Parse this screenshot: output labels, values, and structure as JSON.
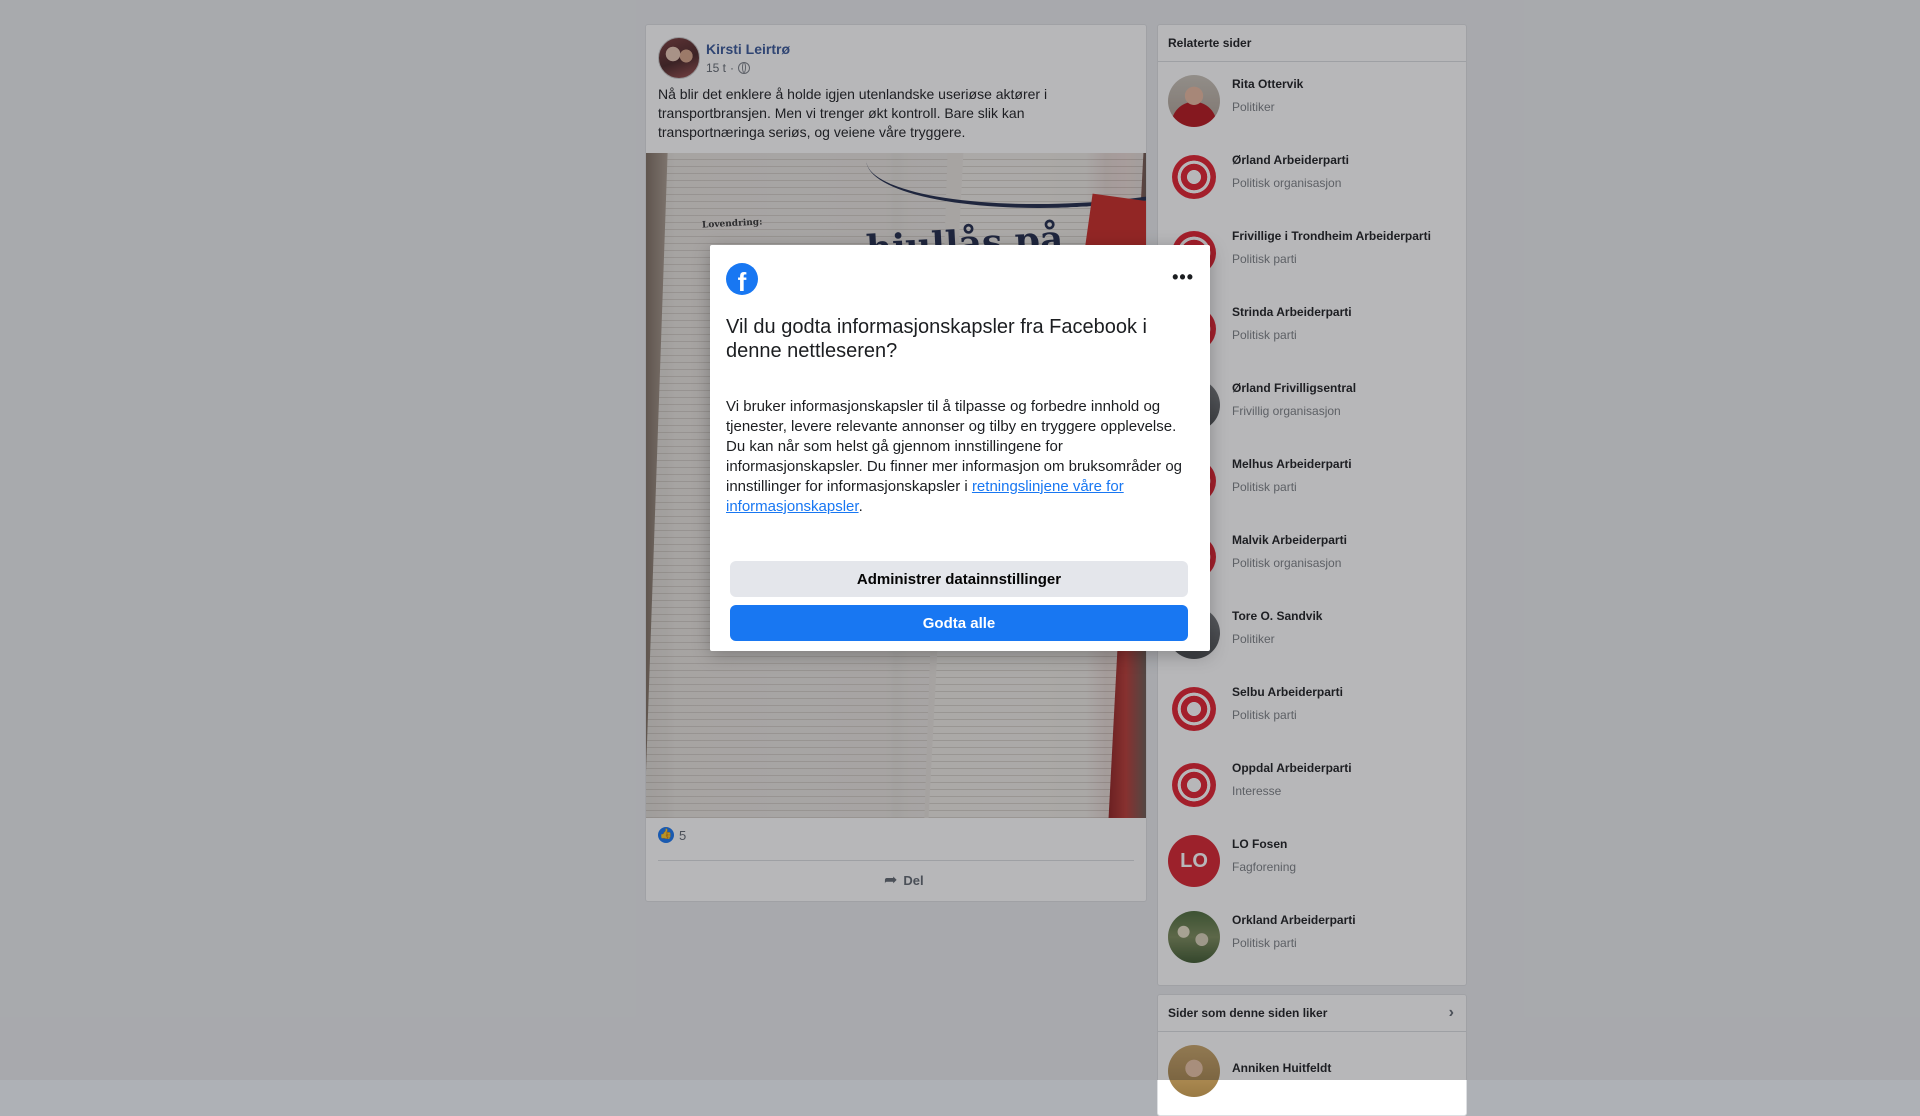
{
  "post": {
    "author": "Kirsti Leirtrø",
    "time": "15 t",
    "text": "Nå blir det enklere å holde igjen utenlandske useriøse aktører i transportbransjen. Men vi trenger økt kontroll. Bare slik kan transportnæringa seriøs, og veiene våre tryggere.",
    "reaction_count": "5",
    "share_label": "Del"
  },
  "related": {
    "title": "Relaterte sider",
    "items": [
      {
        "name": "Rita Ottervik",
        "category": "Politiker"
      },
      {
        "name": "Ørland Arbeiderparti",
        "category": "Politisk organisasjon"
      },
      {
        "name": "Frivillige i Trondheim Arbeiderparti",
        "category": "Politisk parti"
      },
      {
        "name": "Strinda Arbeiderparti",
        "category": "Politisk parti"
      },
      {
        "name": "Ørland Frivilligsentral",
        "category": "Frivillig organisasjon"
      },
      {
        "name": "Melhus Arbeiderparti",
        "category": "Politisk parti"
      },
      {
        "name": "Malvik Arbeiderparti",
        "category": "Politisk organisasjon"
      },
      {
        "name": "Tore O. Sandvik",
        "category": "Politiker"
      },
      {
        "name": "Selbu Arbeiderparti",
        "category": "Politisk parti"
      },
      {
        "name": "Oppdal Arbeiderparti",
        "category": "Interesse"
      },
      {
        "name": "LO Fosen",
        "category": "Fagforening"
      },
      {
        "name": "Orkland Arbeiderparti",
        "category": "Politisk parti"
      }
    ]
  },
  "liked": {
    "title": "Sider som denne siden liker",
    "items": [
      {
        "name": "Anniken Huitfeldt"
      }
    ]
  },
  "dialog": {
    "title": "Vil du godta informasjonskapsler fra Facebook i denne nettleseren?",
    "body": "Vi bruker informasjonskapsler til å tilpasse og forbedre innhold og tjenester, levere relevante annonser og tilby en tryggere opplevelse. Du kan når som helst gå gjennom innstillingene for informasjonskapsler. Du finner mer informasjon om bruksområder og innstillinger for informasjonskapsler i ",
    "link_text": "retningslinjene våre for informasjonskapsler",
    "body_end": ".",
    "manage_label": "Administrer datainnstillinger",
    "accept_label": "Godta alle",
    "more_label": "•••",
    "logo_letter": "f"
  },
  "magazine": {
    "headline": "hjullås på",
    "kicker": "Lovendring:"
  }
}
